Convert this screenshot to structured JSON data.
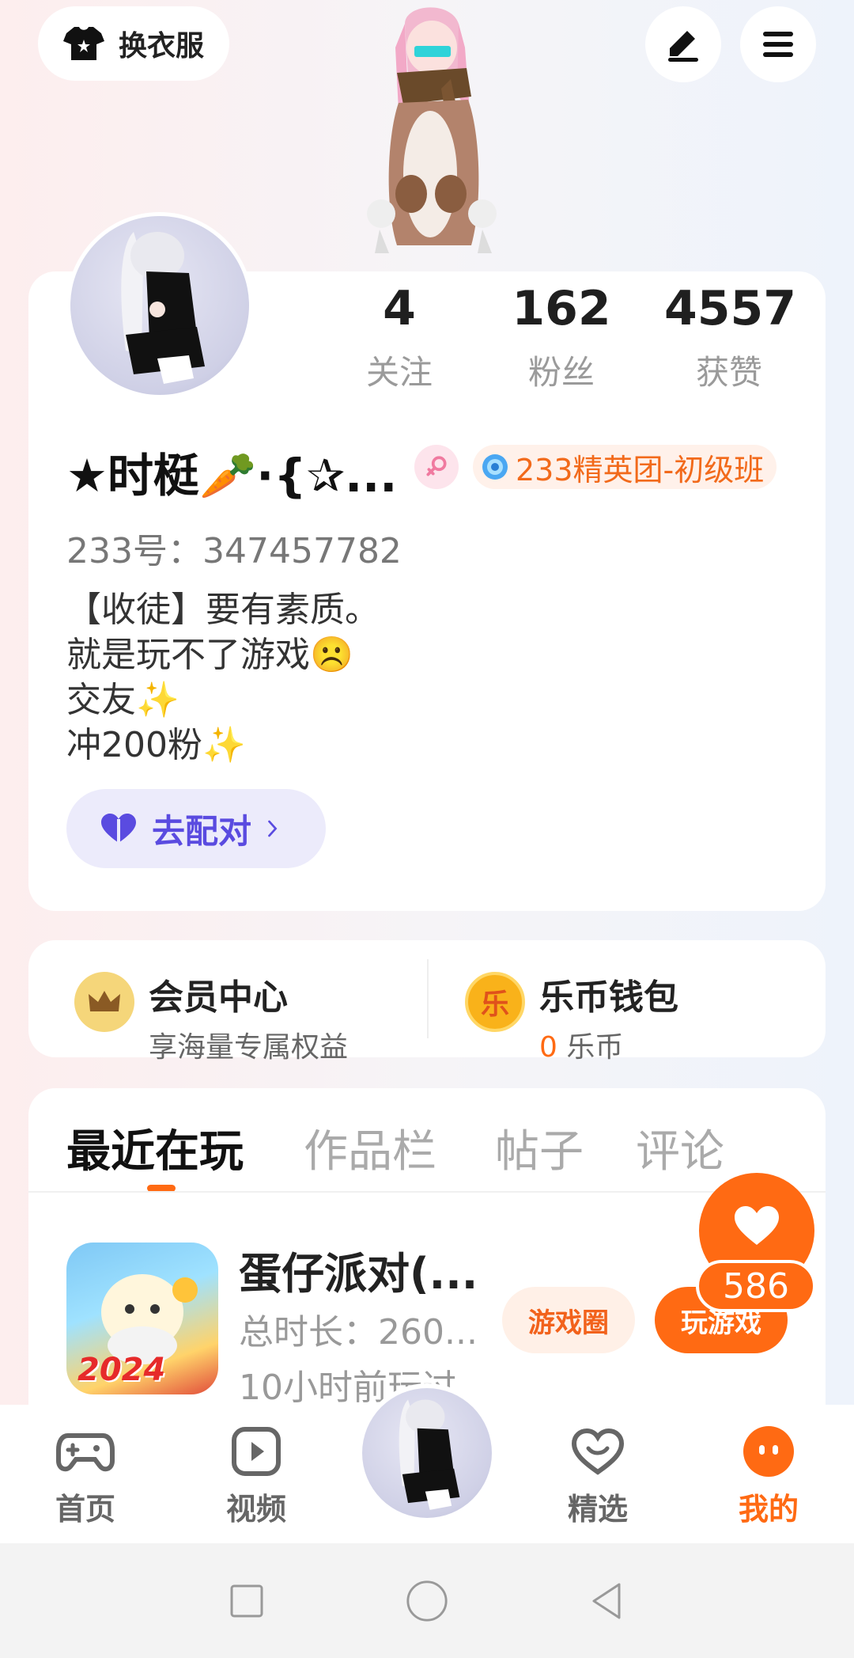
{
  "header": {
    "outfit_label": "换衣服",
    "edit_icon": "pencil-icon",
    "menu_icon": "hamburger-menu-icon"
  },
  "profile": {
    "stats": [
      {
        "value": "4",
        "label": "关注"
      },
      {
        "value": "162",
        "label": "粉丝"
      },
      {
        "value": "4557",
        "label": "获赞"
      }
    ],
    "nickname": "★时梃🥕·{✰...",
    "gender_icon": "female-icon",
    "badge": "233精英团-初级班",
    "uid": "233号：347457782",
    "bio": [
      "【收徒】要有素质。",
      "就是玩不了游戏☹️",
      "交友✨",
      "冲200粉✨"
    ],
    "match_button": "去配对"
  },
  "member_wallet": {
    "member_title": "会员中心",
    "member_sub": "享海量专属权益",
    "wallet_title": "乐币钱包",
    "wallet_amount": "0",
    "wallet_unit": "乐币",
    "wallet_coin_char": "乐"
  },
  "tabs": [
    {
      "label": "最近在玩",
      "active": true
    },
    {
      "label": "作品栏",
      "active": false
    },
    {
      "label": "帖子",
      "active": false
    },
    {
      "label": "评论",
      "active": false
    }
  ],
  "recent_game": {
    "title": "蛋仔派对(...",
    "duration": "总时长：260...",
    "last_played": "10小时前玩过",
    "icon_text": "2024",
    "circle_button": "游戏圈",
    "play_button": "玩游戏"
  },
  "like_float": {
    "count": "586"
  },
  "bottom_nav": [
    {
      "label": "首页",
      "icon": "gamepad-icon",
      "active": false
    },
    {
      "label": "视频",
      "icon": "video-play-icon",
      "active": false
    },
    {
      "label": "精选",
      "icon": "heart-chat-icon",
      "active": false
    },
    {
      "label": "我的",
      "icon": "profile-face-icon",
      "active": true
    }
  ],
  "colors": {
    "accent": "#ff6a13",
    "match_purple": "#5a4be0"
  }
}
